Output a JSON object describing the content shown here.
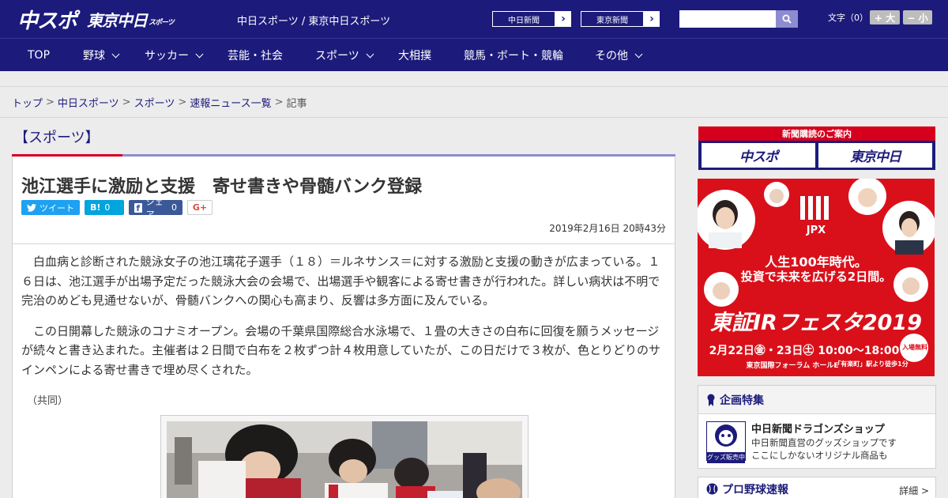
{
  "header": {
    "logo_chuspo": "中スポ",
    "logo_tokyo": "東京中日",
    "logo_tokyo_sub": "スポーツ",
    "site_title": "中日スポーツ / 東京中日スポーツ",
    "ext_links": [
      {
        "label": "中日新聞",
        "arrow": "›"
      },
      {
        "label": "東京新聞",
        "arrow": "›"
      }
    ],
    "search_placeholder": "",
    "font_label": "文字（0）",
    "font_larger": "+ 大",
    "font_smaller": "− 小"
  },
  "nav": {
    "items": [
      {
        "label": "TOP"
      },
      {
        "label": "野球"
      },
      {
        "label": "サッカー"
      },
      {
        "label": "芸能・社会"
      },
      {
        "label": "スポーツ"
      },
      {
        "label": "大相撲"
      },
      {
        "label": "競馬・ボート・競輪"
      },
      {
        "label": "その他"
      }
    ]
  },
  "breadcrumb": {
    "items": [
      "トップ",
      "中日スポーツ",
      "スポーツ",
      "速報ニュース一覧"
    ],
    "current": "記事",
    "separator": ">"
  },
  "article": {
    "section": "【スポーツ】",
    "headline": "池江選手に激励と支援　寄せ書きや骨髄バンク登録",
    "share": {
      "tweet": "ツイート",
      "hatena": "B!",
      "hatena_count": "0",
      "facebook": "シェア",
      "facebook_count": "0",
      "gplus": "G+"
    },
    "date": "2019年2月16日 20時43分",
    "paragraphs": [
      "白血病と診断された競泳女子の池江璃花子選手（１８）＝ルネサンス＝に対する激励と支援の動きが広まっている。１６日は、池江選手が出場予定だった競泳大会の会場で、出場選手や観客による寄せ書きが行われた。詳しい病状は不明で完治のめども見通せないが、骨髄バンクへの関心も高まり、反響は多方面に及んでいる。",
      "この日開幕した競泳のコナミオープン。会場の千葉県国際総合水泳場で、１畳の大きさの白布に回復を願うメッセージが続々と書き込まれた。主催者は２日間で白布を２枚ずつ計４枚用意していたが、この日だけで３枚が、色とりどりのサインペンによる寄せ書きで埋め尽くされた。"
    ],
    "credit": "（共同）"
  },
  "sidebar": {
    "subscribe_head": "新聞購読のご案内",
    "subscribe_logos": [
      "中スポ",
      "東京中日"
    ],
    "ad": {
      "brand": "JPX",
      "line1": "人生100年時代。",
      "line2": "投資で未来を広げる2日間。",
      "event": "東証IRフェスタ2019",
      "dates": "2月22日㊎・23日㊏ 10:00～18:00",
      "venue": "東京国際フォーラム ホールE",
      "access": "「有楽町」駅より徒歩1分",
      "badge": "入場無料"
    },
    "feature": {
      "title": "企画特集",
      "item_title": "中日新聞ドラゴンズショップ",
      "item_desc1": "中日新聞直営のグッズショップです",
      "item_desc2": "ここにしかないオリジナル商品も",
      "thumb_label": "グッズ販売中"
    },
    "baseball": {
      "title": "プロ野球速報",
      "more": "詳細 >"
    }
  },
  "colors": {
    "brand_navy": "#1c1b7b",
    "accent_red": "#d6001c",
    "accent_lavender": "#8d8cd0"
  }
}
